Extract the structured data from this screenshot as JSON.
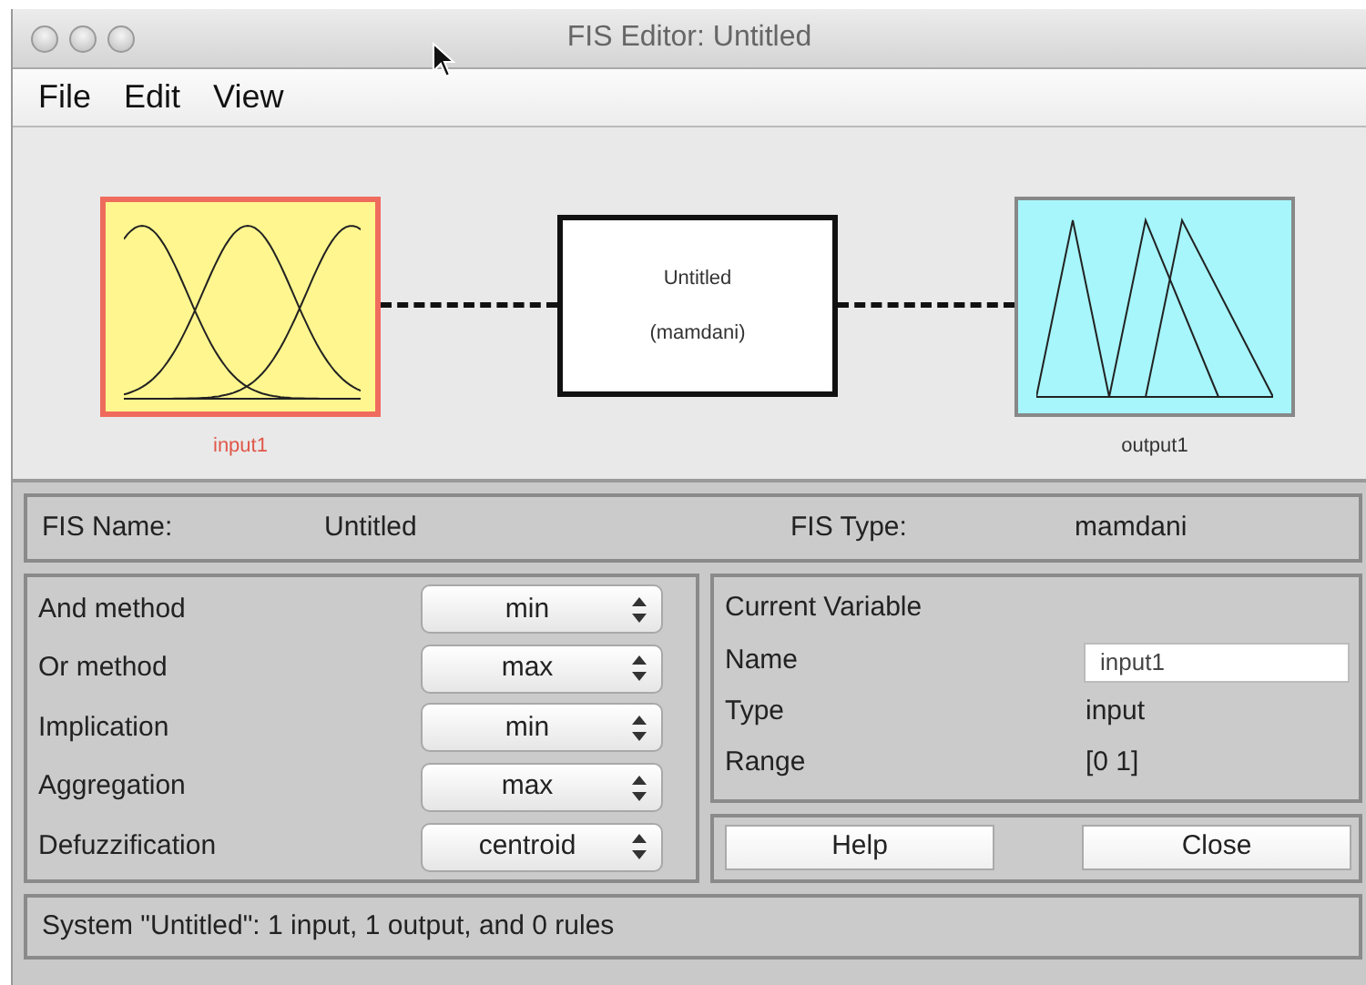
{
  "window": {
    "title": "FIS Editor: Untitled"
  },
  "menu": [
    "File",
    "Edit",
    "View"
  ],
  "diagram": {
    "inputs": [
      {
        "name": "input1",
        "selected": true
      }
    ],
    "system": {
      "name": "Untitled",
      "type": "(mamdani)"
    },
    "outputs": [
      {
        "name": "output1",
        "selected": false
      }
    ]
  },
  "fis": {
    "name_label": "FIS Name:",
    "name": "Untitled",
    "type_label": "FIS Type:",
    "type": "mamdani"
  },
  "methods": [
    {
      "label": "And method",
      "value": "min"
    },
    {
      "label": "Or method",
      "value": "max"
    },
    {
      "label": "Implication",
      "value": "min"
    },
    {
      "label": "Aggregation",
      "value": "max"
    },
    {
      "label": "Defuzzification",
      "value": "centroid"
    }
  ],
  "current_variable": {
    "heading": "Current Variable",
    "fields": [
      {
        "label": "Name",
        "value": "input1",
        "kind": "field"
      },
      {
        "label": "Type",
        "value": "input",
        "kind": "text"
      },
      {
        "label": "Range",
        "value": "[0 1]",
        "kind": "text"
      }
    ]
  },
  "buttons": [
    "Help",
    "Close"
  ],
  "status": "System \"Untitled\": 1 input, 1 output, and 0 rules"
}
